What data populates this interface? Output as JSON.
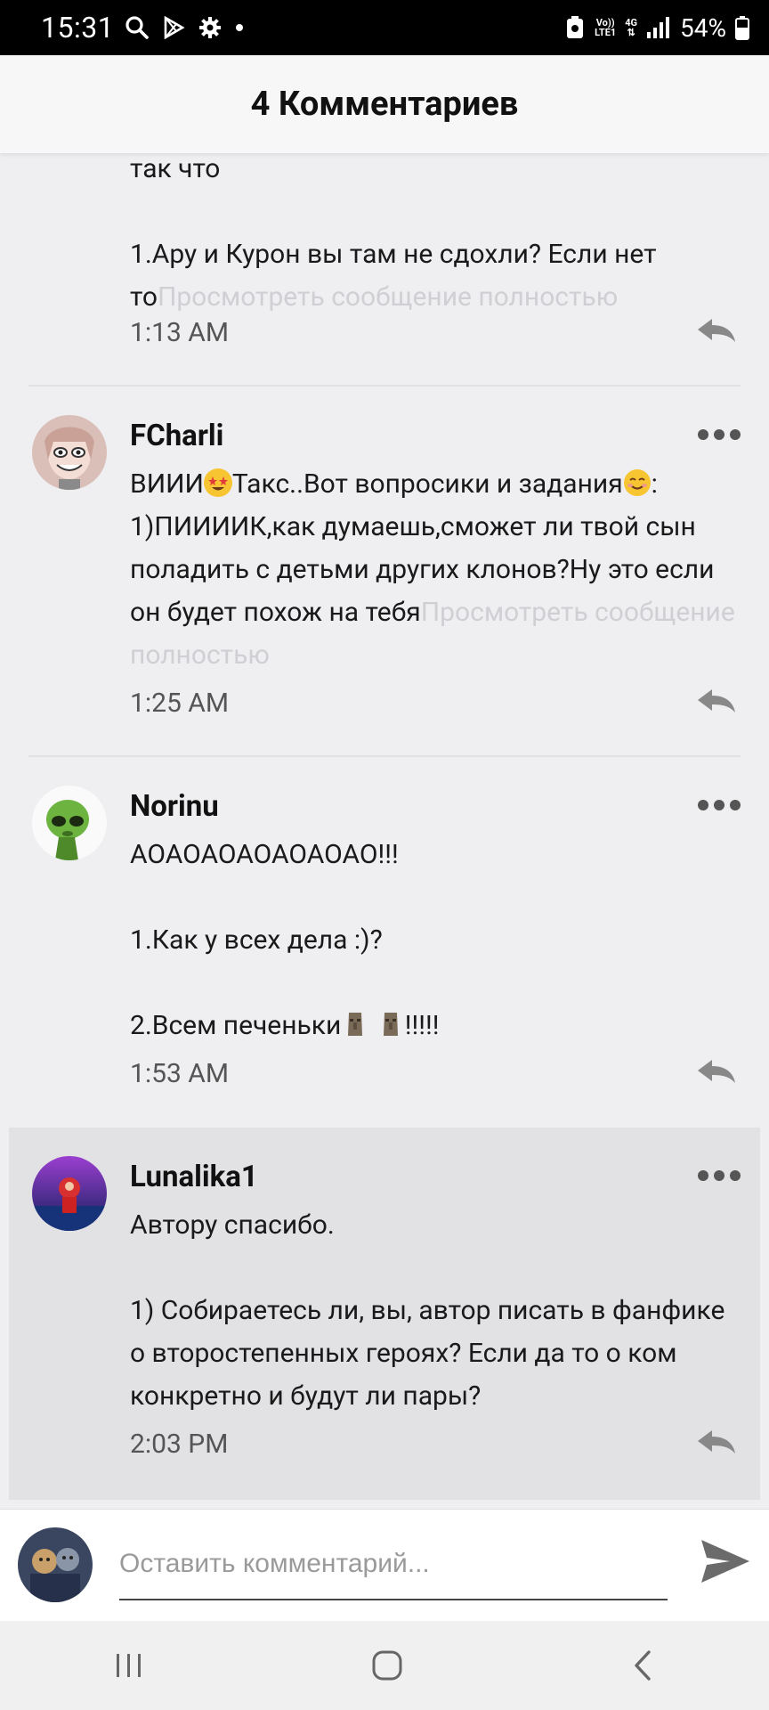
{
  "status_bar": {
    "time": "15:31",
    "battery": "54%",
    "network_top": "Vo))",
    "network_bottom": "LTE1",
    "signal_label": "4G"
  },
  "header": {
    "title": "4 Комментариев"
  },
  "comments": [
    {
      "author": "",
      "text": "так что\n\n1.Ару и Курон вы там не сдохли? Если нет то",
      "more": "Просмотреть сообщение полностью",
      "time": "1:13 AM"
    },
    {
      "author": "FCharli",
      "text_a": "ВИИИ",
      "text_b": "Такс..Вот вопросики и задания",
      "text_c": ":\n1)ПИИИИК,как думаешь,сможет ли твой сын поладить с детьми других клонов?Ну это если он будет похож на тебя",
      "more": "Просмотреть сообщение полностью",
      "time": "1:25 AM"
    },
    {
      "author": "Norinu",
      "text": "АОАОАОАОАОАОАО!!!\n\n1.Как у всех дела :)?\n\n",
      "text_end_a": "2.Всем печеньки",
      "text_end_b": "!!!!!",
      "time": "1:53 AM"
    },
    {
      "author": "Lunalika1",
      "text": "Автору спасибо.\n\n1) Собираетесь ли, вы, автор писать в фанфике о второстепенных героях? Если да то о ком конкретно и будут ли пары?",
      "time": "2:03 PM"
    }
  ],
  "composer": {
    "placeholder": "Оставить комментарий..."
  },
  "colors": {
    "highlight_bg": "#e2e1e4",
    "list_bg": "#efeef0",
    "more_link": "#d0cfd3"
  },
  "icons": [
    "search-icon",
    "play-store-icon",
    "gear-icon",
    "reply-icon",
    "more-dots-icon",
    "send-icon",
    "recents-icon",
    "home-icon",
    "back-icon"
  ]
}
